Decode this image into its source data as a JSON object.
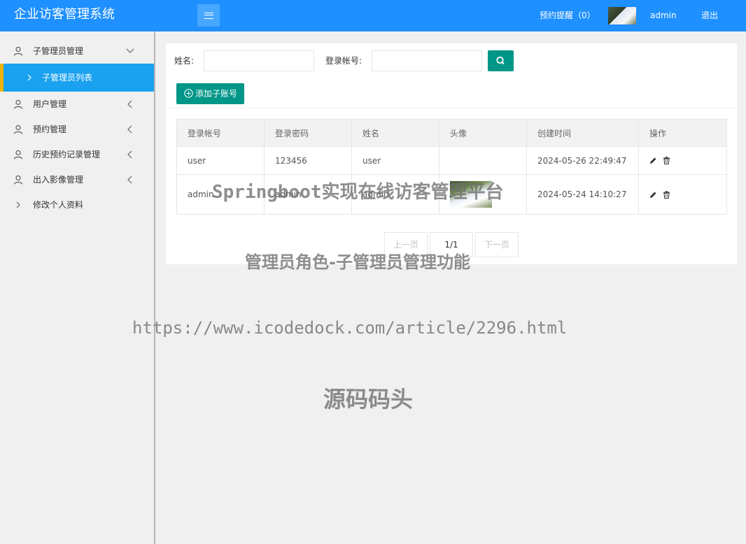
{
  "header": {
    "app_title": "企业访客管理系统",
    "reminder_label": "预约提醒（0）",
    "username": "admin",
    "logout_label": "退出"
  },
  "sidebar": {
    "items": [
      {
        "label": "子管理员管理",
        "icon": "user-icon",
        "expanded": true
      },
      {
        "label": "用户管理",
        "icon": "user-icon"
      },
      {
        "label": "预约管理",
        "icon": "user-icon"
      },
      {
        "label": "历史预约记录管理",
        "icon": "user-icon"
      },
      {
        "label": "出入影像管理",
        "icon": "user-icon"
      },
      {
        "label": "修改个人资料",
        "icon": "chevron-right-icon"
      }
    ],
    "active_sub_item": "子管理员列表"
  },
  "filters": {
    "name_label": "姓名:",
    "name_value": "",
    "account_label": "登录帐号:",
    "account_value": ""
  },
  "toolbar": {
    "add_label": "添加子账号"
  },
  "table": {
    "headers": [
      "登录帐号",
      "登录密码",
      "姓名",
      "头像",
      "创建时间",
      "操作"
    ],
    "rows": [
      {
        "account": "user",
        "password": "123456",
        "name": "user",
        "has_avatar": false,
        "created": "2024-05-26 22:49:47"
      },
      {
        "account": "admin",
        "password": "admin",
        "name": "admin",
        "has_avatar": true,
        "created": "2024-05-24 14:10:27"
      }
    ]
  },
  "pagination": {
    "prev_label": "上一页",
    "current": "1/1",
    "next_label": "下一页"
  },
  "watermarks": {
    "line1": "Springboot实现在线访客管理平台",
    "line2": "管理员角色-子管理员管理功能",
    "line3": "https://www.icodedock.com/article/2296.html",
    "line4": "源码码头"
  },
  "colors": {
    "header_bg": "#1e90ff",
    "active_nav_bg": "#1aa1f0",
    "active_nav_accent": "#f0b400",
    "primary_button": "#009688"
  }
}
